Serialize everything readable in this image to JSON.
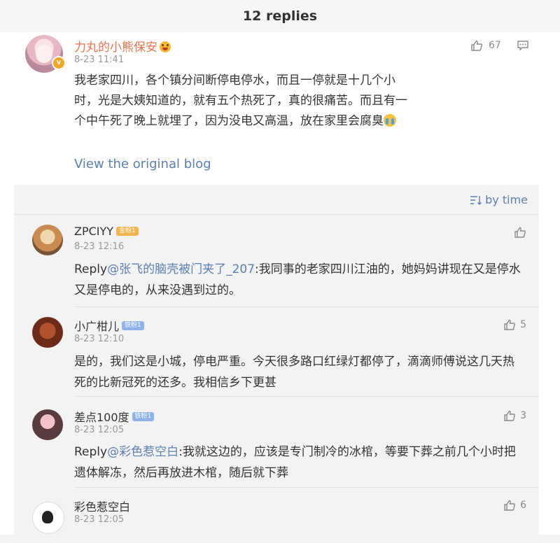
{
  "header": {
    "title": "12 replies"
  },
  "main_comment": {
    "username": "力丸的小熊保安",
    "time": "8-23 11:41",
    "likes": "67",
    "text": "我老家四川，各个镇分间断停电停水，而且一停就是十几个小时，光是大姨知道的，就有五个热死了，真的很痛苦。而且有一个中午死了晚上就埋了，因为没电又高温，放在家里会腐臭",
    "view_original": "View the original blog"
  },
  "sort": {
    "label": "by time",
    "icon": "sort-icon"
  },
  "replies": [
    {
      "username": "ZPCIYY",
      "badge": "金粉1",
      "time": "8-23 12:16",
      "likes": "",
      "reply_prefix": "Reply",
      "mention": "@张飞的脑壳被门夹了_207",
      "text": ":我同事的老家四川江油的，她妈妈讲现在又是停水又是停电的，从来没遇到过的。"
    },
    {
      "username": "小广柑儿",
      "badge": "铁粉1",
      "time": "8-23 12:10",
      "likes": "5",
      "text": "是的，我们这是小城，停电严重。今天很多路口红绿灯都停了，滴滴师傅说这几天热死的比新冠死的还多。我相信乡下更甚"
    },
    {
      "username": "差点100度",
      "badge": "铁粉1",
      "time": "8-23 12:05",
      "likes": "3",
      "reply_prefix": "Reply",
      "mention": "@彩色惹空白",
      "text": ":我就这边的，应该是专门制冷的冰棺，等要下葬之前几个小时把遗体解冻，然后再放进木棺，随后就下葬"
    },
    {
      "username": "彩色惹空白",
      "time": "8-23 12:05",
      "likes": "6"
    }
  ],
  "colors": {
    "link": "#5b7fb3",
    "username_main": "#eb7350",
    "panel": "#f3f3f3"
  }
}
